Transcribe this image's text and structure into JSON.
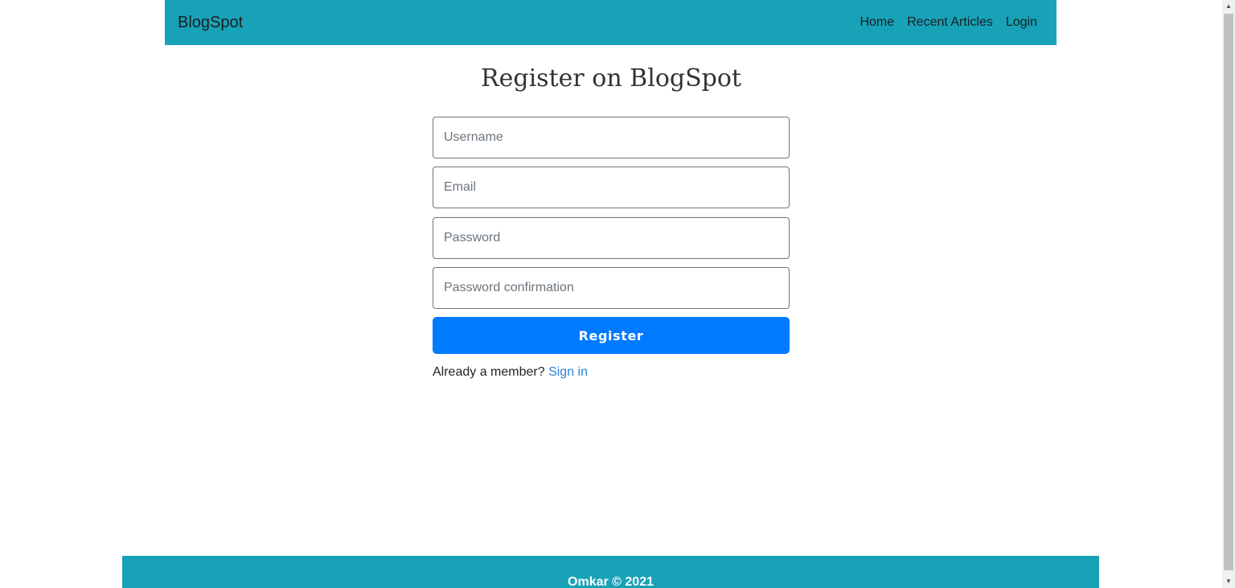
{
  "navbar": {
    "brand": "BlogSpot",
    "links": [
      "Home",
      "Recent Articles",
      "Login"
    ],
    "bg_color": "#17a2b8"
  },
  "form": {
    "title": "Register on BlogSpot",
    "fields": {
      "username_placeholder": "Username",
      "email_placeholder": "Email",
      "password_placeholder": "Password",
      "password_confirmation_placeholder": "Password confirmation"
    },
    "submit_label": "Register",
    "submit_color": "#007bff",
    "member_prompt": "Already a member?",
    "signin_label": "Sign in"
  },
  "footer": {
    "text": "Omkar © 2021"
  },
  "scrollbar": {
    "up_icon": "▲",
    "down_icon": "▼"
  }
}
